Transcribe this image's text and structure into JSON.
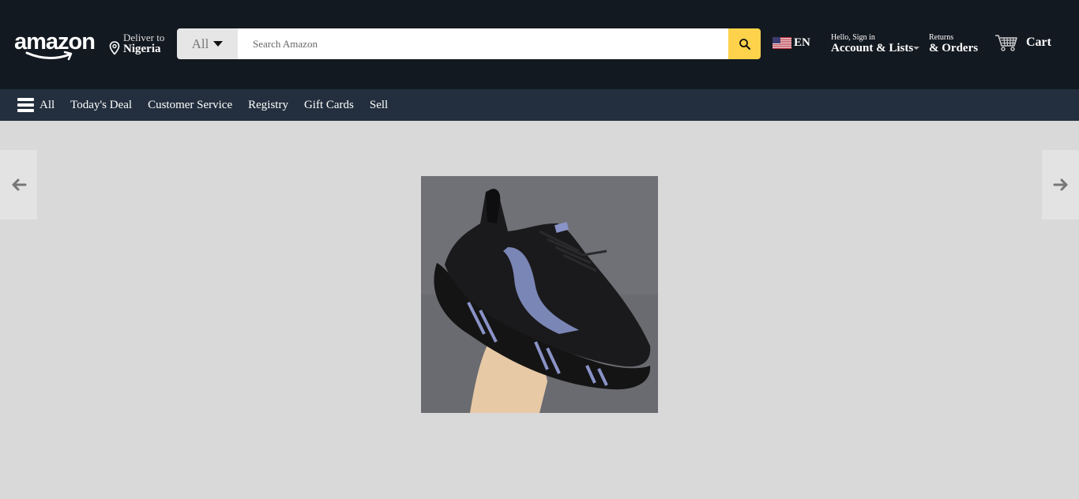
{
  "header": {
    "logo_text": "amazon",
    "deliver": {
      "line1": "Deliver to",
      "line2": "Nigeria"
    },
    "search": {
      "category": "All",
      "placeholder": "Search Amazon"
    },
    "language": "EN",
    "account": {
      "small": "Hello, Sign in",
      "big": "Account & Lists"
    },
    "orders": {
      "small": "Returns",
      "big": "& Orders"
    },
    "cart": "Cart"
  },
  "nav": {
    "all": "All",
    "items": [
      "Today's Deal",
      "Customer Service",
      "Registry",
      "Gift Cards",
      "Sell"
    ]
  },
  "carousel": {
    "prev_icon": "arrow-left-icon",
    "next_icon": "arrow-right-icon",
    "image": "black-sneaker"
  },
  "colors": {
    "header_bg": "#131921",
    "nav_bg": "#232f3e",
    "search_button": "#fed24a",
    "page_bg": "#d9d9d9"
  }
}
